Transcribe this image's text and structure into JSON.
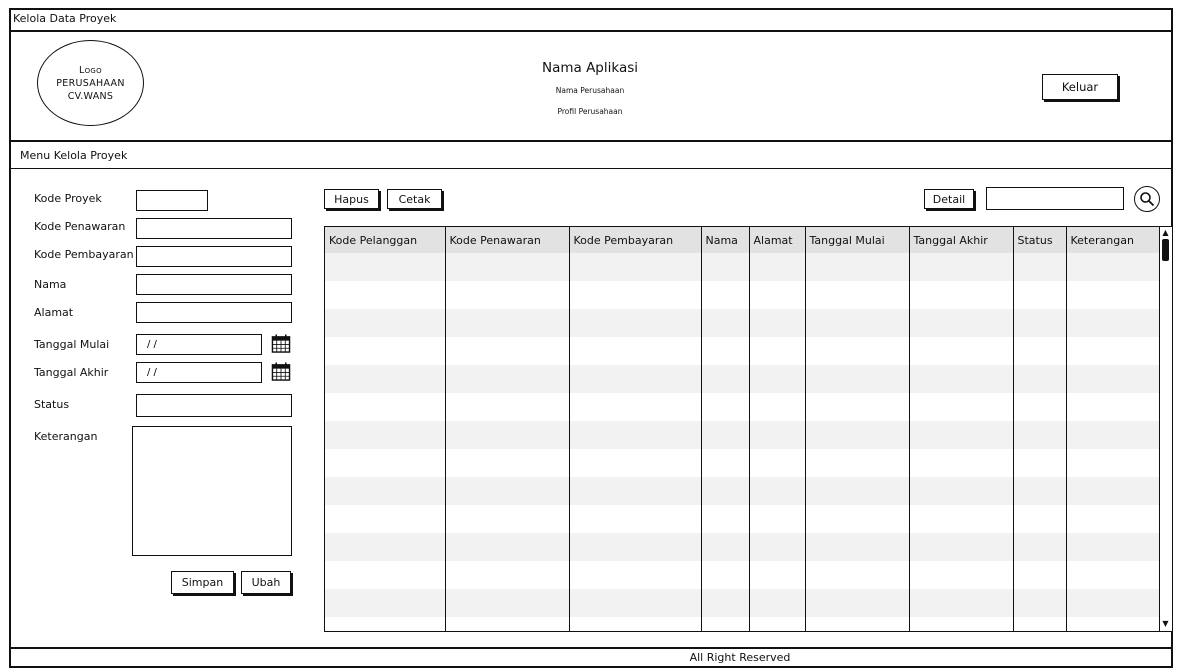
{
  "window": {
    "title": "Kelola Data Proyek"
  },
  "header": {
    "logo_lines": [
      "Logo",
      "PERUSAHAAN",
      "CV.WANS"
    ],
    "app_name": "Nama Aplikasi",
    "company_name": "Nama Perusahaan",
    "company_profile": "Profil Perusahaan",
    "logout_label": "Keluar"
  },
  "menu": {
    "title": "Menu Kelola Proyek"
  },
  "form": {
    "kode_proyek_label": "Kode Proyek",
    "kode_penawaran_label": "Kode Penawaran",
    "kode_pembayaran_label": "Kode Pembayaran",
    "nama_label": "Nama",
    "alamat_label": "Alamat",
    "tanggal_mulai_label": "Tanggal Mulai",
    "tanggal_mulai_value": "/ /",
    "tanggal_akhir_label": "Tanggal Akhir",
    "tanggal_akhir_value": "/ /",
    "status_label": "Status",
    "keterangan_label": "Keterangan",
    "save_label": "Simpan",
    "update_label": "Ubah"
  },
  "toolbar": {
    "delete_label": "Hapus",
    "print_label": "Cetak",
    "detail_label": "Detail",
    "search_value": ""
  },
  "table": {
    "columns": [
      "Kode Pelanggan",
      "Kode Penawaran",
      "Kode Pembayaran",
      "Nama",
      "Alamat",
      "Tanggal Mulai",
      "Tanggal Akhir",
      "Status",
      "Keterangan"
    ],
    "row_count": 14
  },
  "footer": {
    "text": "All Right Reserved"
  },
  "icons": {
    "calendar": "calendar-icon",
    "search": "search-icon",
    "scroll_up": "arrow-up-icon",
    "scroll_down": "arrow-down-icon"
  }
}
